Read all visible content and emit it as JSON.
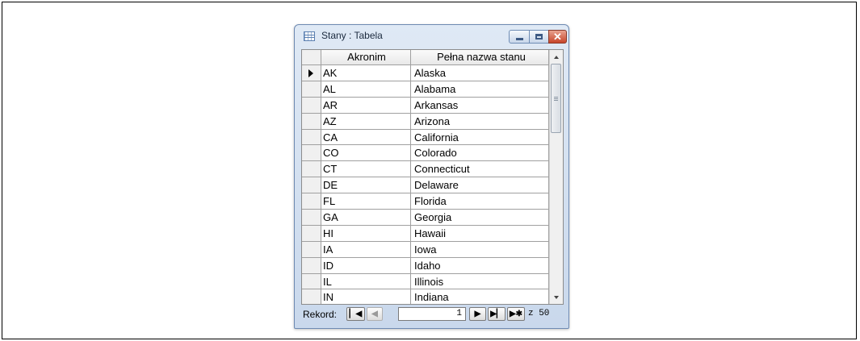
{
  "window": {
    "title": "Stany : Tabela",
    "icons": {
      "table": "table-icon",
      "minimize": "minimize-icon",
      "maximize": "maximize-icon",
      "close": "close-icon"
    }
  },
  "table": {
    "columns": [
      "Akronim",
      "Pełna nazwa stanu"
    ],
    "current_row_index": 0,
    "rows": [
      {
        "acronym": "AK",
        "name": "Alaska"
      },
      {
        "acronym": "AL",
        "name": "Alabama"
      },
      {
        "acronym": "AR",
        "name": "Arkansas"
      },
      {
        "acronym": "AZ",
        "name": "Arizona"
      },
      {
        "acronym": "CA",
        "name": "California"
      },
      {
        "acronym": "CO",
        "name": "Colorado"
      },
      {
        "acronym": "CT",
        "name": "Connecticut"
      },
      {
        "acronym": "DE",
        "name": "Delaware"
      },
      {
        "acronym": "FL",
        "name": "Florida"
      },
      {
        "acronym": "GA",
        "name": "Georgia"
      },
      {
        "acronym": "HI",
        "name": "Hawaii"
      },
      {
        "acronym": "IA",
        "name": "Iowa"
      },
      {
        "acronym": "ID",
        "name": "Idaho"
      },
      {
        "acronym": "IL",
        "name": "Illinois"
      },
      {
        "acronym": "IN",
        "name": "Indiana"
      }
    ]
  },
  "navigator": {
    "label": "Rekord:",
    "current": "1",
    "total_text": "z 50",
    "buttons": {
      "first": "▏◀",
      "prev": "◀",
      "next": "▶",
      "last": "▶▏",
      "new": "▶✱"
    }
  }
}
